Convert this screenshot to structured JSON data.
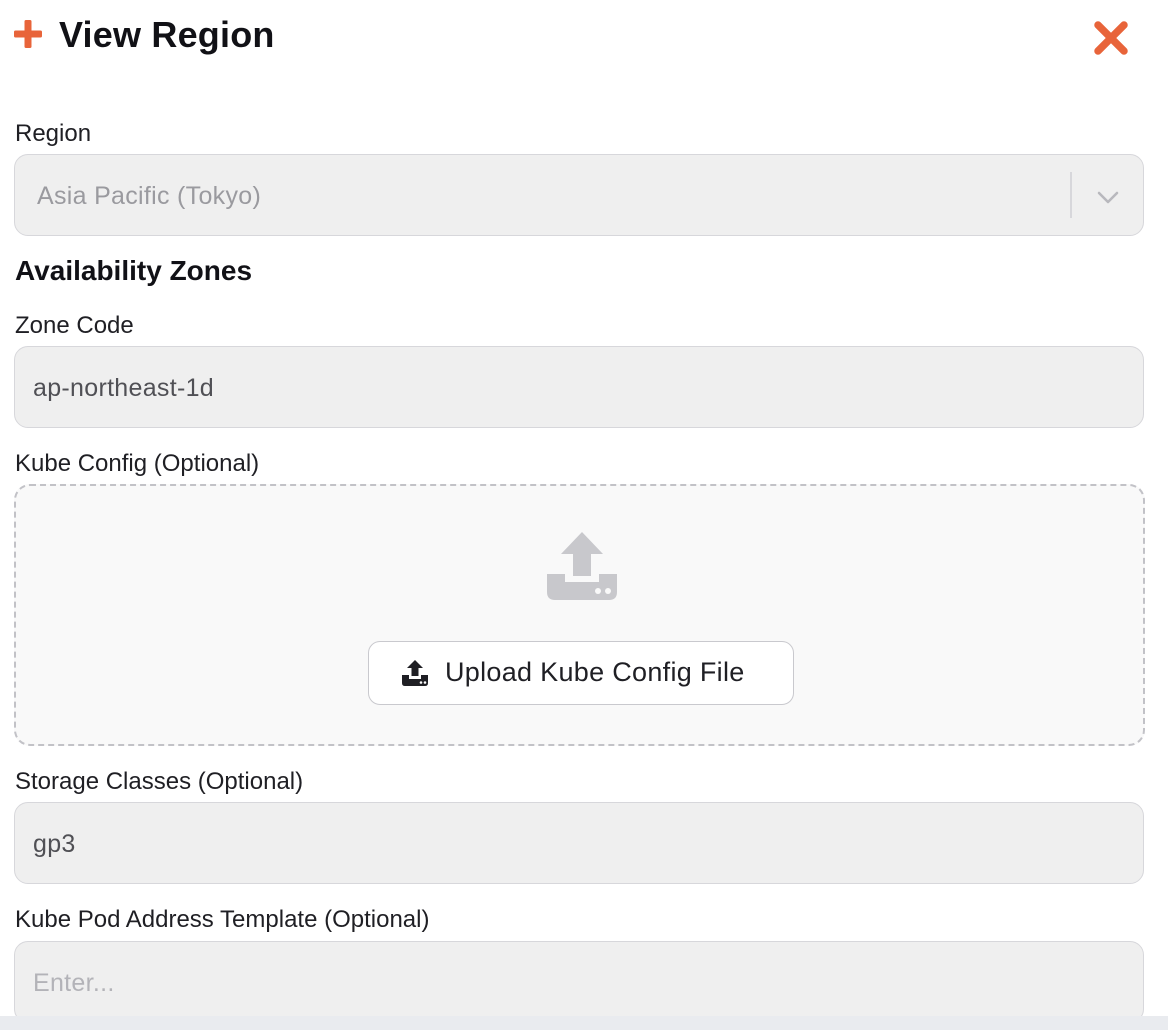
{
  "header": {
    "title": "View Region",
    "plus_icon": "plus-icon",
    "close_icon": "close-icon",
    "accent_color": "#e8643a"
  },
  "region": {
    "label": "Region",
    "selected_value": "Asia Pacific (Tokyo)",
    "dropdown_icon": "chevron-down-icon"
  },
  "availability_zones": {
    "heading": "Availability Zones",
    "zone_code": {
      "label": "Zone Code",
      "value": "ap-northeast-1d"
    },
    "kube_config": {
      "label": "Kube Config (Optional)",
      "dropzone_icon": "upload-icon",
      "upload_button_label": "Upload Kube Config File",
      "upload_button_icon": "upload-icon"
    },
    "storage_classes": {
      "label": "Storage Classes (Optional)",
      "value": "gp3"
    },
    "kube_pod_address_template": {
      "label": "Kube Pod Address Template (Optional)",
      "value": "",
      "placeholder": "Enter..."
    }
  }
}
